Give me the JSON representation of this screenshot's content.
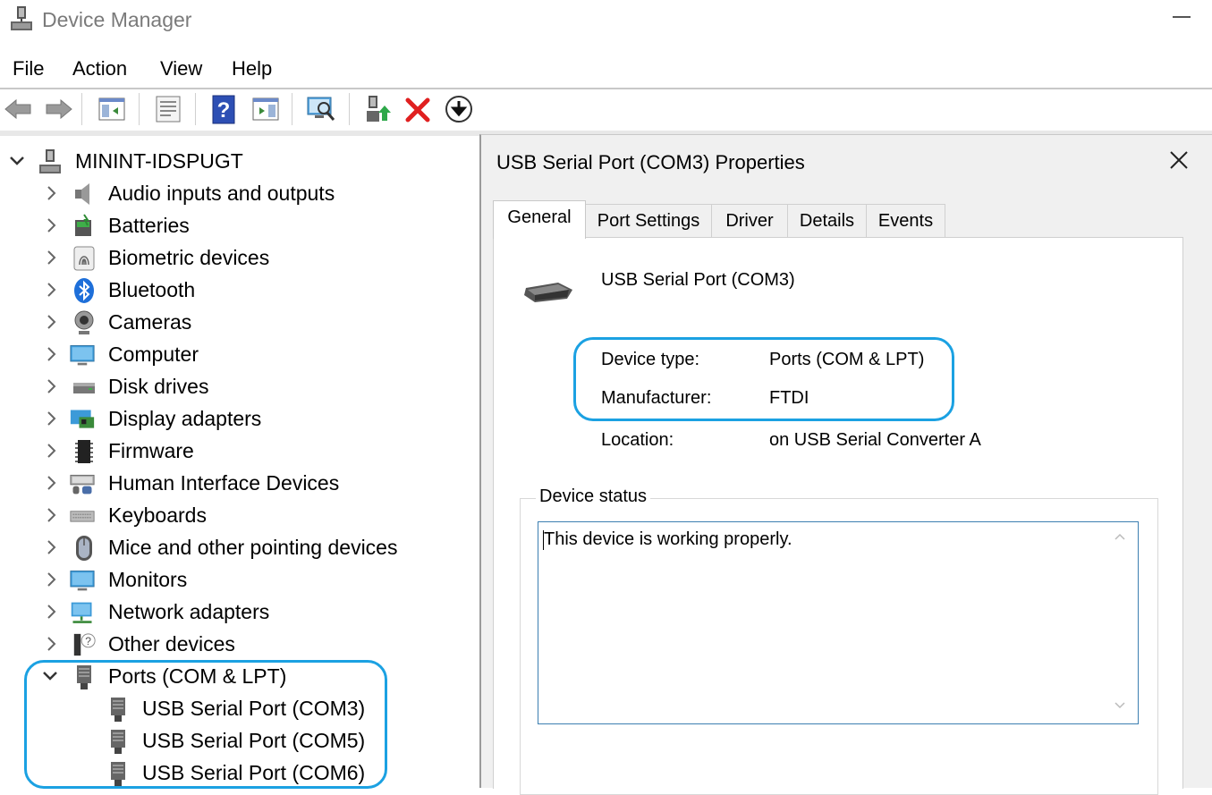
{
  "window": {
    "title": "Device Manager"
  },
  "menu": {
    "items": [
      "File",
      "Action",
      "View",
      "Help"
    ]
  },
  "toolbar": {
    "buttons": [
      "back-icon",
      "forward-icon",
      "show-hide-console-tree-icon",
      "properties-icon",
      "help-icon",
      "action-pane-icon",
      "scan-hardware-icon",
      "update-driver-icon",
      "uninstall-icon",
      "disable-device-icon"
    ]
  },
  "tree": {
    "root": "MININT-IDSPUGT",
    "categories": [
      "Audio inputs and outputs",
      "Batteries",
      "Biometric devices",
      "Bluetooth",
      "Cameras",
      "Computer",
      "Disk drives",
      "Display adapters",
      "Firmware",
      "Human Interface Devices",
      "Keyboards",
      "Mice and other pointing devices",
      "Monitors",
      "Network adapters",
      "Other devices",
      "Ports (COM & LPT)"
    ],
    "ports_children": [
      "USB Serial Port (COM3)",
      "USB Serial Port (COM5)",
      "USB Serial Port (COM6)"
    ]
  },
  "dialog": {
    "title": "USB Serial Port (COM3) Properties",
    "tabs": [
      "General",
      "Port Settings",
      "Driver",
      "Details",
      "Events"
    ],
    "active_tab": "General",
    "device_name": "USB Serial Port (COM3)",
    "device_type_label": "Device type:",
    "device_type_value": "Ports (COM & LPT)",
    "manufacturer_label": "Manufacturer:",
    "manufacturer_value": "FTDI",
    "location_label": "Location:",
    "location_value": "on USB Serial Converter A",
    "status_legend": "Device status",
    "status_text": "This device is working properly."
  },
  "colors": {
    "highlight": "#1ba1e2",
    "selection_border": "#3c7fb1"
  }
}
